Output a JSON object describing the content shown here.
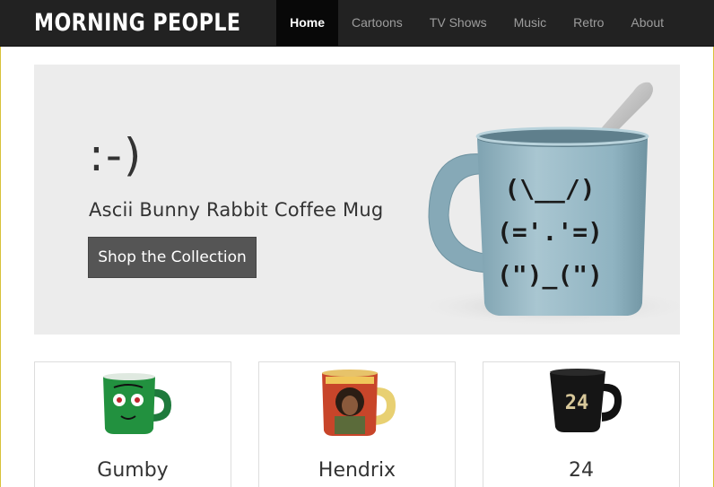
{
  "brand": {
    "logo_text": "Morning People"
  },
  "nav": {
    "items": [
      {
        "label": "Home",
        "active": true
      },
      {
        "label": "Cartoons",
        "active": false
      },
      {
        "label": "TV Shows",
        "active": false
      },
      {
        "label": "Music",
        "active": false
      },
      {
        "label": "Retro",
        "active": false
      },
      {
        "label": "About",
        "active": false
      }
    ]
  },
  "hero": {
    "smiley": ":-)",
    "subtitle": "Ascii Bunny Rabbit Coffee Mug",
    "button_label": "Shop the Collection",
    "mug_lines": [
      "(\\__/)",
      "(='.'=)",
      "(\")_(\")"
    ]
  },
  "products": [
    {
      "name": "Gumby",
      "icon": "gumby-mug-icon"
    },
    {
      "name": "Hendrix",
      "icon": "hendrix-mug-icon"
    },
    {
      "name": "24",
      "icon": "24-mug-icon"
    }
  ],
  "colors": {
    "navbar": "#222222",
    "nav_active": "#080808",
    "hero_bg": "#ececec",
    "button": "#555555",
    "mug_blue": "#8fb3c1"
  }
}
